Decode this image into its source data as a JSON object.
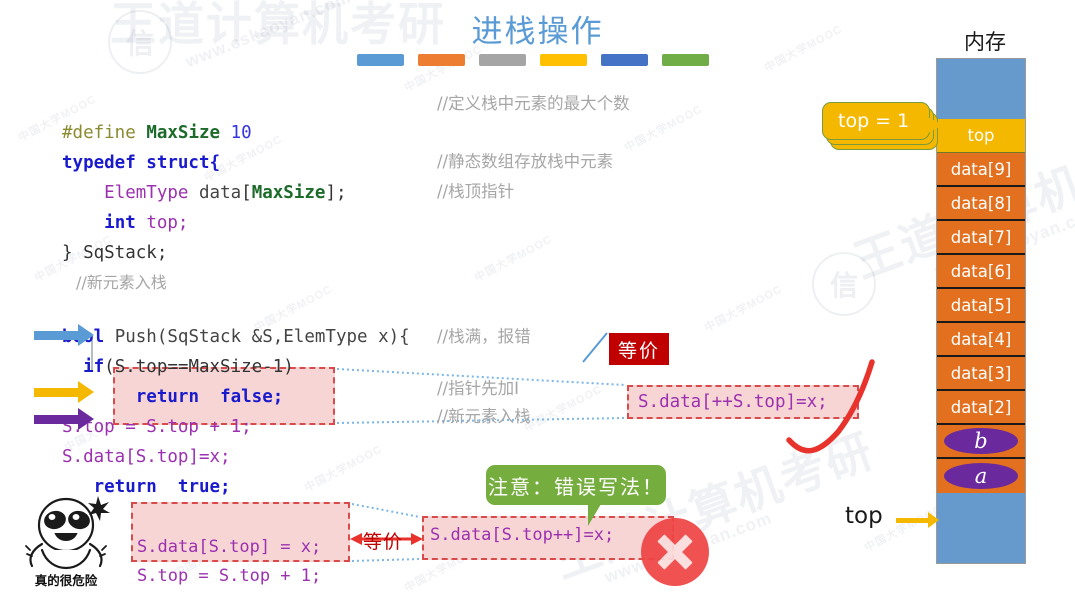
{
  "slide": {
    "title": "进栈操作",
    "accent_swatches": [
      "#5b9bd5",
      "#ed7d31",
      "#a5a5a5",
      "#ffc000",
      "#4472c4",
      "#70ad47"
    ]
  },
  "code_struct": {
    "l1_define": "#define",
    "l1_name": "MaxSize",
    "l1_value": "10",
    "l1_comment": "//定义栈中元素的最大个数",
    "l2": "typedef struct{",
    "l3_type": "ElemType",
    "l3_name": "data",
    "l3_idx_open": "[",
    "l3_idx": "MaxSize",
    "l3_idx_close": "];",
    "l3_comment": "//静态数组存放栈中元素",
    "l4_type": "int",
    "l4_name": "top;",
    "l4_comment": "//栈顶指针",
    "l5": "} SqStack;"
  },
  "code_push": {
    "c1": "//新元素入栈",
    "c2_kw": "bool",
    "c2_rest": " Push(SqStack &S,ElemType x){",
    "c3_kw": "if",
    "c3_rest": "(S.top==MaxSize-1)",
    "c3_comment": "//栈满，报错",
    "c4_kw": "return",
    "c4_val": "false;",
    "c5": "S.top = S.top + 1;",
    "c5_comment": "//指针先加I",
    "c6": "S.data[S.top]=x;",
    "c6_comment": "//新元素入栈",
    "c7_kw": "return",
    "c7_val": "true;",
    "c8": "}"
  },
  "annotations": {
    "equivalent_label": "等价",
    "equivalent_code": "S.data[++S.top]=x;",
    "warning_label": "注意：错误写法！",
    "wrong_equivalent_label": "等价",
    "bottom_left_line1": "S.data[S.top] = x;",
    "bottom_left_line2": "S.top = S.top + 1;",
    "bottom_right_code": "S.data[S.top++]=x;",
    "error_icon": "x-circle-icon",
    "mascot_caption": "真的很危险",
    "callout_top_value": "top = 1"
  },
  "memory": {
    "heading": "内存",
    "pointer_label": "top",
    "top_cell_label": "top",
    "cells": [
      {
        "label": "data[9]",
        "kind": "orange"
      },
      {
        "label": "data[8]",
        "kind": "orange"
      },
      {
        "label": "data[7]",
        "kind": "orange"
      },
      {
        "label": "data[6]",
        "kind": "orange"
      },
      {
        "label": "data[5]",
        "kind": "orange"
      },
      {
        "label": "data[4]",
        "kind": "orange"
      },
      {
        "label": "data[3]",
        "kind": "orange"
      },
      {
        "label": "data[2]",
        "kind": "orange"
      },
      {
        "label": "b",
        "kind": "ellipse"
      },
      {
        "label": "a",
        "kind": "ellipse"
      }
    ],
    "colors": {
      "free": "#6699cc",
      "top_cell": "#f5b800",
      "used": "#e2701e",
      "element": "#6a2a9e"
    }
  },
  "watermarks": {
    "brand_cn": "王道计算机考研",
    "brand_url": "www.cskaoyan.com",
    "mooc": "中国大学MOOC"
  }
}
